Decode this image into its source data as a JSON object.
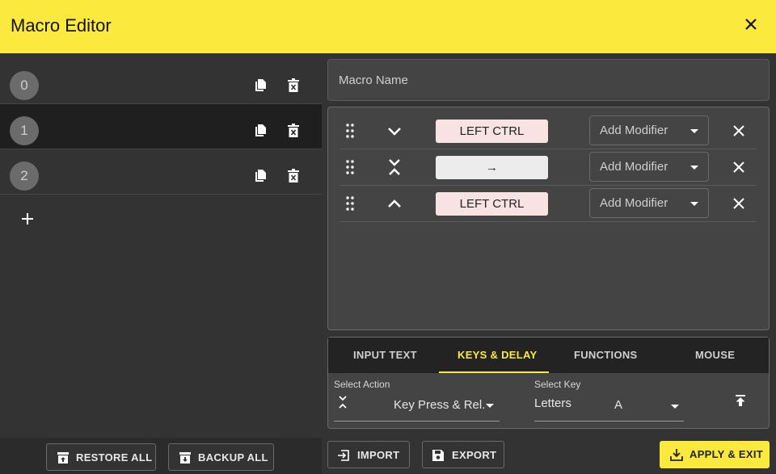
{
  "header": {
    "title": "Macro Editor",
    "close_icon": "close-icon"
  },
  "macros": [
    {
      "number": "0",
      "active": false
    },
    {
      "number": "1",
      "active": true
    },
    {
      "number": "2",
      "active": false
    }
  ],
  "left_footer": {
    "restore_label": "RESTORE ALL",
    "backup_label": "BACKUP ALL"
  },
  "macro_name": {
    "placeholder": "Macro Name",
    "value": ""
  },
  "steps": [
    {
      "action_icon": "key-down-icon",
      "key": "LEFT CTRL",
      "chip": "pink",
      "modifier": "Add Modifier"
    },
    {
      "action_icon": "key-press-release-icon",
      "key": "→",
      "chip": "gray",
      "modifier": "Add Modifier"
    },
    {
      "action_icon": "key-up-icon",
      "key": "LEFT CTRL",
      "chip": "pink",
      "modifier": "Add Modifier"
    }
  ],
  "tabs": [
    {
      "label": "INPUT TEXT",
      "active": false
    },
    {
      "label": "KEYS & DELAY",
      "active": true
    },
    {
      "label": "FUNCTIONS",
      "active": false
    },
    {
      "label": "MOUSE",
      "active": false
    }
  ],
  "action_select": {
    "label": "Select Action",
    "value": "Key Press & Rel."
  },
  "key_select": {
    "label": "Select Key",
    "category": "Letters",
    "value": "A"
  },
  "footer": {
    "import_label": "IMPORT",
    "export_label": "EXPORT",
    "apply_label": "APPLY & EXIT"
  },
  "colors": {
    "accent": "#fbe93d",
    "background": "#333333",
    "panel": "#444444",
    "chip_pink": "#f9e2e2"
  }
}
